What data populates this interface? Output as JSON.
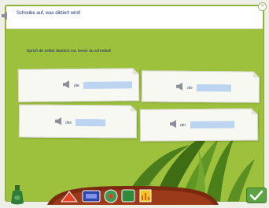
{
  "instruction": {
    "text": "Schreibe auf, was diktiert wird!"
  },
  "hint": "Sprich dir selbst deutsch vor, bevor du schreibst!",
  "cards": [
    {
      "article": "die",
      "answer": ""
    },
    {
      "article": "die",
      "answer": ""
    },
    {
      "article": "das",
      "answer": ""
    },
    {
      "article": "der",
      "answer": ""
    }
  ],
  "colors": {
    "board": "#9dc13c",
    "answer_field": "#bcd4f0",
    "text": "#1f2b6b",
    "paper": "#f8f8f3"
  },
  "icons": [
    "speaker-icon",
    "close-icon",
    "bottle-icon",
    "red-arrow-icon",
    "dictionary-icon",
    "gauge-icon",
    "green-box-icon",
    "bar-chart-icon",
    "check-icon"
  ]
}
